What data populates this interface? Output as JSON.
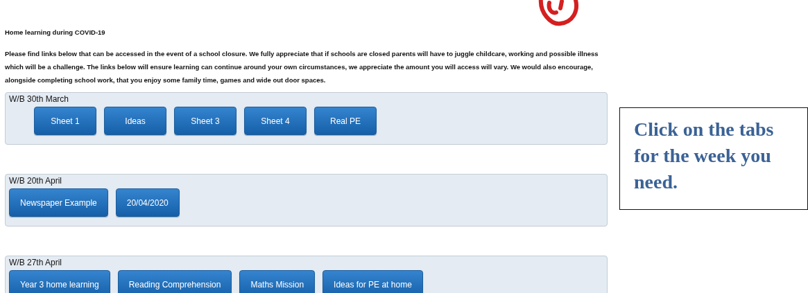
{
  "heading": "Home learning during COVID-19",
  "intro": "Please find links below that can be accessed in the event of a school closure. We fully appreciate that if schools are closed parents will have to juggle childcare, working and possible illness which will be a challenge. The links below will ensure learning can continue around your own circumstances, we appreciate the amount you will access will vary. We would also encourage, alongside completing school work, that you enjoy some family time, games and wide out door spaces.",
  "weeks": [
    {
      "title": "W/B 30th March",
      "links": [
        "Sheet 1",
        "Ideas",
        "Sheet 3",
        "Sheet 4",
        "Real PE"
      ]
    },
    {
      "title": "W/B 20th April",
      "links": [
        "Newspaper Example",
        "20/04/2020"
      ]
    },
    {
      "title": "W/B 27th April",
      "links": [
        "Year 3 home learning",
        "Reading Comprehension",
        "Maths Mission",
        "Ideas for PE at home"
      ]
    }
  ],
  "callout": "Click on the tabs for the week you need."
}
